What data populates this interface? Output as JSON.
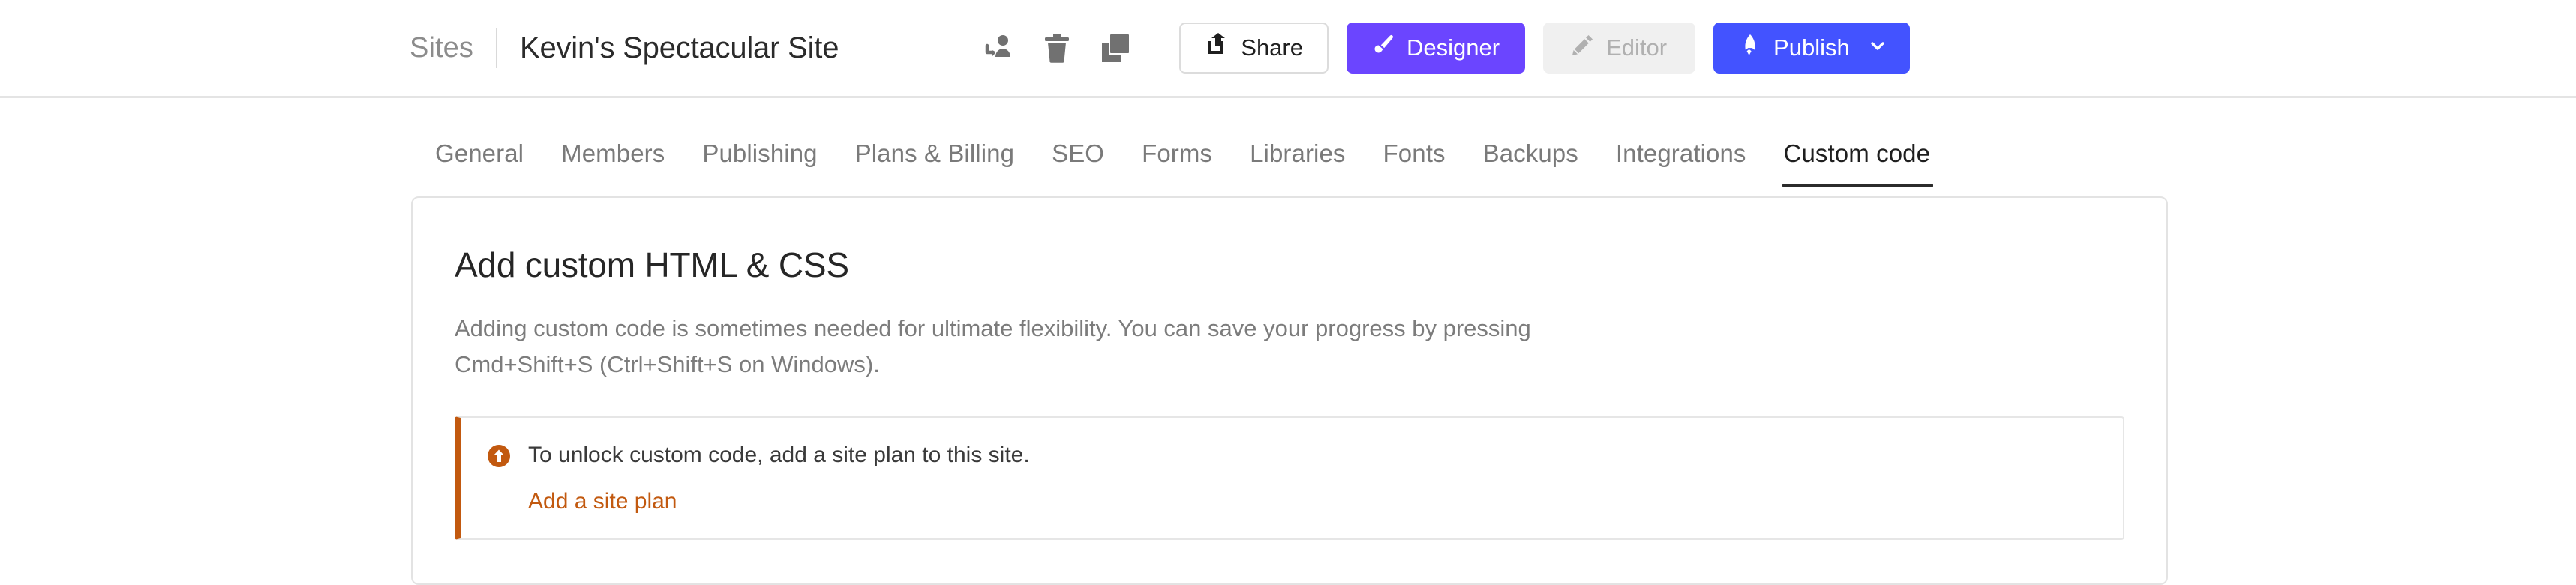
{
  "header": {
    "breadcrumb_root": "Sites",
    "site_title": "Kevin's Spectacular Site",
    "icons": [
      {
        "name": "transfer-site-icon",
        "label": "Transfer site"
      },
      {
        "name": "trash-icon",
        "label": "Delete site"
      },
      {
        "name": "duplicate-icon",
        "label": "Duplicate site"
      }
    ],
    "share_label": "Share",
    "designer_label": "Designer",
    "editor_label": "Editor",
    "publish_label": "Publish",
    "colors": {
      "designer_bg": "#6B45FF",
      "publish_bg": "#4353FF",
      "editor_bg": "#f0f0f0",
      "editor_text": "#b0b0b0"
    }
  },
  "tabs": [
    {
      "label": "General",
      "active": false
    },
    {
      "label": "Members",
      "active": false
    },
    {
      "label": "Publishing",
      "active": false
    },
    {
      "label": "Plans & Billing",
      "active": false
    },
    {
      "label": "SEO",
      "active": false
    },
    {
      "label": "Forms",
      "active": false
    },
    {
      "label": "Libraries",
      "active": false
    },
    {
      "label": "Fonts",
      "active": false
    },
    {
      "label": "Backups",
      "active": false
    },
    {
      "label": "Integrations",
      "active": false
    },
    {
      "label": "Custom code",
      "active": true
    }
  ],
  "main": {
    "card_title": "Add custom HTML & CSS",
    "card_description": "Adding custom code is sometimes needed for ultimate flexibility. You can save your progress by pressing Cmd+Shift+S (Ctrl+Shift+S on Windows).",
    "alert": {
      "icon": "upgrade-arrow-circle-icon",
      "message": "To unlock custom code, add a site plan to this site.",
      "link_label": "Add a site plan",
      "accent_color": "#C2590F"
    }
  }
}
